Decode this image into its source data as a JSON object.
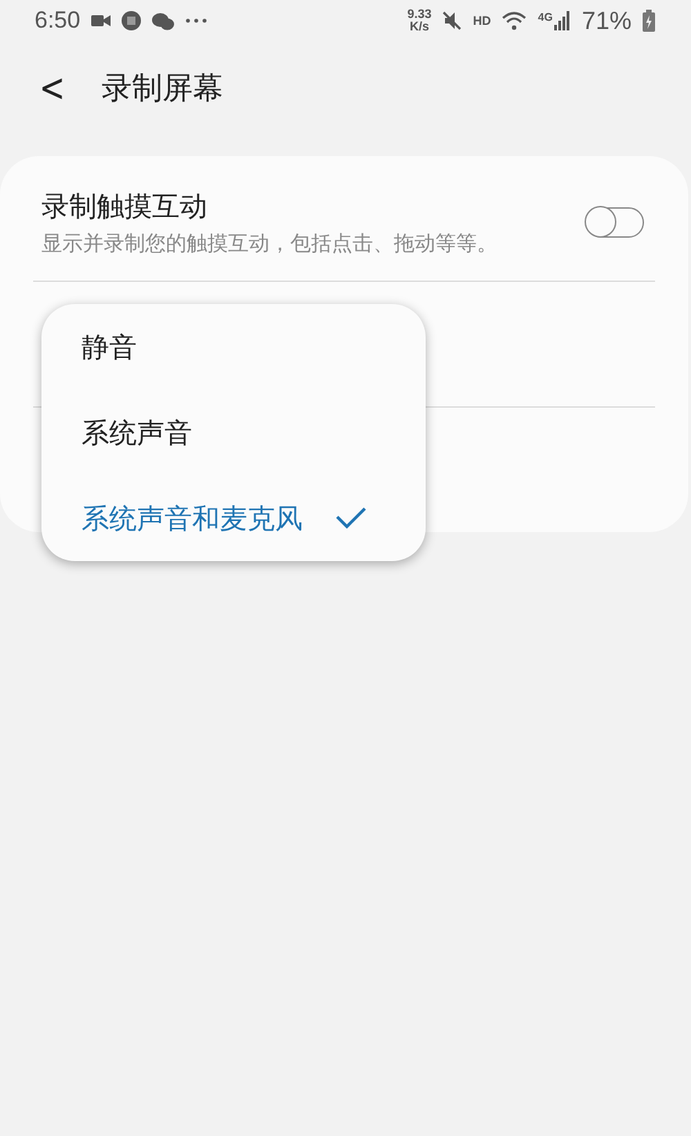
{
  "status_bar": {
    "time": "6:50",
    "speed_value": "9.33",
    "speed_unit": "K/s",
    "hd": "HD",
    "network": "4G",
    "battery": "71%"
  },
  "header": {
    "back": "<",
    "title": "录制屏幕"
  },
  "settings": [
    {
      "kind": "switch",
      "title": "录制触摸互动",
      "subtitle": "显示并录制您的触摸互动，包括点击、拖动等等。",
      "on": false
    },
    {
      "kind": "blank"
    },
    {
      "kind": "blank"
    }
  ],
  "menu": {
    "items": [
      {
        "label": "静音",
        "selected": false
      },
      {
        "label": "系统声音",
        "selected": false
      },
      {
        "label": "系统声音和麦克风",
        "selected": true
      }
    ]
  }
}
